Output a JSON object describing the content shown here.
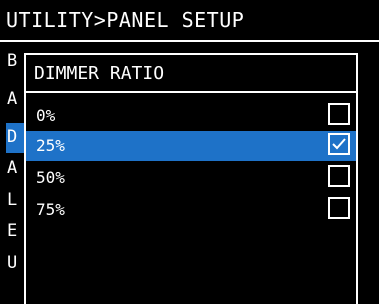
{
  "header": {
    "title": "UTILITY>PANEL SETUP"
  },
  "background_menu": {
    "letters": [
      "B",
      "A",
      "D",
      "A",
      "L",
      "E",
      "U"
    ],
    "selected_index": 2
  },
  "dialog": {
    "title": "DIMMER RATIO",
    "options": [
      {
        "label": "0%",
        "checked": false
      },
      {
        "label": "25%",
        "checked": true
      },
      {
        "label": "50%",
        "checked": false
      },
      {
        "label": "75%",
        "checked": false
      }
    ]
  },
  "colors": {
    "highlight": "#1e72c8",
    "foreground": "#ffffff",
    "background": "#000000"
  }
}
